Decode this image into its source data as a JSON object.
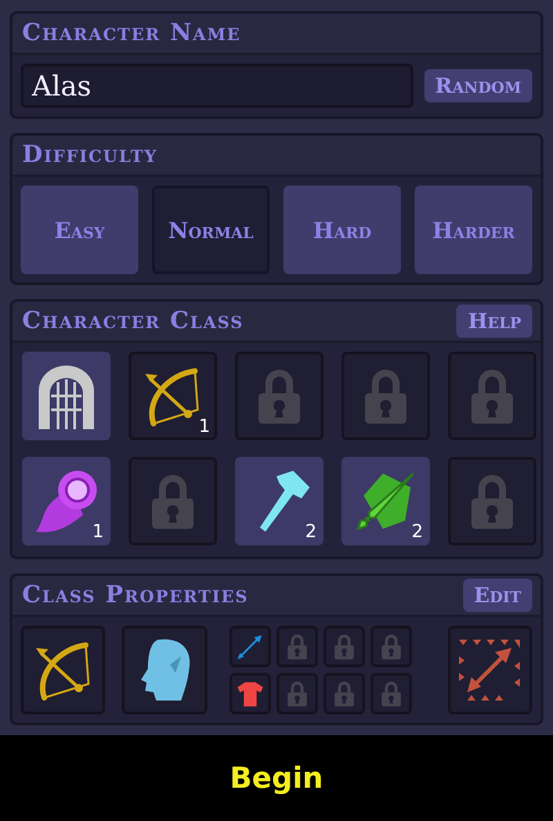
{
  "name_panel": {
    "title": "Character Name",
    "name_value": "Alas",
    "random_button": "Random"
  },
  "difficulty": {
    "title": "Difficulty",
    "options": [
      {
        "label": "Easy",
        "selected": false
      },
      {
        "label": "Normal",
        "selected": true
      },
      {
        "label": "Hard",
        "selected": false
      },
      {
        "label": "Harder",
        "selected": false
      }
    ]
  },
  "character_class": {
    "title": "Character Class",
    "help_button": "Help",
    "classes": [
      {
        "kind": "gate",
        "highlighted": true
      },
      {
        "kind": "bow",
        "highlighted": false,
        "count": "1"
      },
      {
        "kind": "locked",
        "highlighted": false
      },
      {
        "kind": "locked",
        "highlighted": false
      },
      {
        "kind": "locked",
        "highlighted": false
      },
      {
        "kind": "fireball",
        "highlighted": true,
        "count": "1"
      },
      {
        "kind": "locked",
        "highlighted": false
      },
      {
        "kind": "hammer",
        "highlighted": true,
        "count": "2"
      },
      {
        "kind": "sword-shield",
        "highlighted": true,
        "count": "2"
      },
      {
        "kind": "locked",
        "highlighted": false
      }
    ]
  },
  "class_properties": {
    "title": "Class Properties",
    "edit_button": "Edit",
    "weapon": {
      "kind": "bow"
    },
    "race": {
      "kind": "elf-head"
    },
    "slots": [
      {
        "kind": "arrow"
      },
      {
        "kind": "locked"
      },
      {
        "kind": "locked"
      },
      {
        "kind": "locked"
      },
      {
        "kind": "shirt"
      },
      {
        "kind": "locked"
      },
      {
        "kind": "locked"
      },
      {
        "kind": "locked"
      }
    ],
    "ability": {
      "kind": "arrow-frame"
    }
  },
  "begin_button": "Begin"
}
